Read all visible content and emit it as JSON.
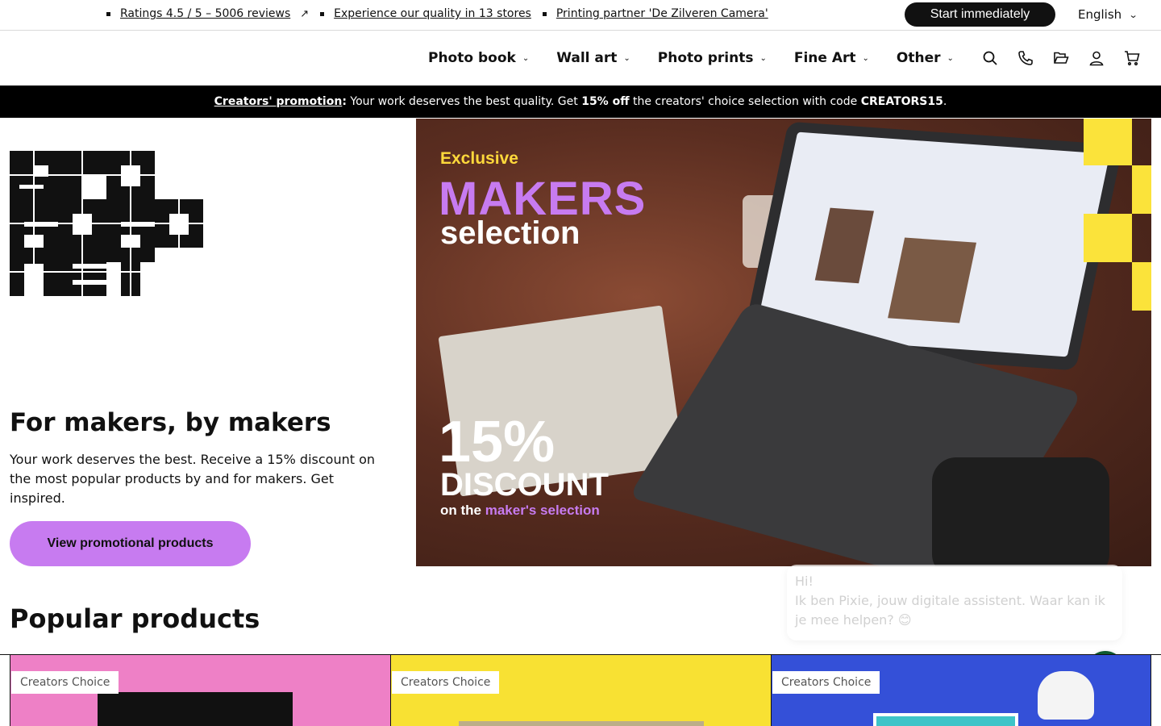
{
  "topbar": {
    "usps": [
      {
        "label": "Ratings 4.5 / 5 – 5006 reviews",
        "external": true
      },
      {
        "label": "Experience our quality in 13 stores",
        "external": false
      },
      {
        "label": "Printing partner 'De Zilveren Camera'",
        "external": false
      }
    ],
    "start_label": "Start immediately",
    "language": "English"
  },
  "nav": {
    "items": [
      "Photo book",
      "Wall art",
      "Photo prints",
      "Fine Art",
      "Other"
    ],
    "icons": [
      "search-icon",
      "phone-icon",
      "folder-icon",
      "user-icon",
      "cart-icon"
    ]
  },
  "promo": {
    "icon": "",
    "link": "Creators' promotion",
    "colon": ":",
    "text1": " Your work deserves the best quality. Get ",
    "bold1": "15% off",
    "text2": " the creators' choice selection with code ",
    "code": "CREATORS15",
    "end": "."
  },
  "logo": {
    "text": "pro foto net"
  },
  "hero": {
    "title": "For makers, by makers",
    "subtitle": "Your work deserves the best. Receive a 15% discount on the most popular products by and for makers. Get inspired.",
    "button": "View promotional products",
    "image_text": {
      "exclusive": "Exclusive",
      "makers": "MAKERS",
      "selection": "selection",
      "percent": "15%",
      "discount": "DISCOUNT",
      "on_the": "on the ",
      "makers_selection": "maker's selection"
    }
  },
  "chat": {
    "line1": "Hi!",
    "line2": "Ik ben Pixie, jouw digitale assistent. Waar kan ik je mee helpen? 😊"
  },
  "popular": {
    "title": "Popular products",
    "products": [
      {
        "tag": "Creators Choice"
      },
      {
        "tag": "Creators Choice"
      },
      {
        "tag": "Creators Choice"
      }
    ]
  },
  "colors": {
    "accent": "#c77bf0",
    "promo_bg": "#000000",
    "chat_button": "#0f5a2f",
    "yellow": "#fbe33a"
  }
}
